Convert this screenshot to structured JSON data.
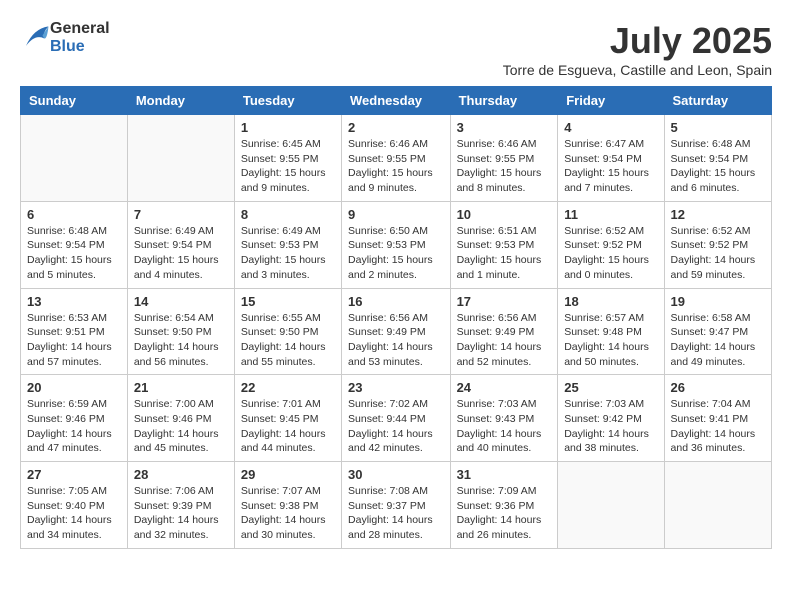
{
  "header": {
    "logo_general": "General",
    "logo_blue": "Blue",
    "month_title": "July 2025",
    "location": "Torre de Esgueva, Castille and Leon, Spain"
  },
  "calendar": {
    "days_of_week": [
      "Sunday",
      "Monday",
      "Tuesday",
      "Wednesday",
      "Thursday",
      "Friday",
      "Saturday"
    ],
    "weeks": [
      [
        {
          "day": "",
          "sunrise": "",
          "sunset": "",
          "daylight": "",
          "empty": true
        },
        {
          "day": "",
          "sunrise": "",
          "sunset": "",
          "daylight": "",
          "empty": true
        },
        {
          "day": "1",
          "sunrise": "Sunrise: 6:45 AM",
          "sunset": "Sunset: 9:55 PM",
          "daylight": "Daylight: 15 hours and 9 minutes."
        },
        {
          "day": "2",
          "sunrise": "Sunrise: 6:46 AM",
          "sunset": "Sunset: 9:55 PM",
          "daylight": "Daylight: 15 hours and 9 minutes."
        },
        {
          "day": "3",
          "sunrise": "Sunrise: 6:46 AM",
          "sunset": "Sunset: 9:55 PM",
          "daylight": "Daylight: 15 hours and 8 minutes."
        },
        {
          "day": "4",
          "sunrise": "Sunrise: 6:47 AM",
          "sunset": "Sunset: 9:54 PM",
          "daylight": "Daylight: 15 hours and 7 minutes."
        },
        {
          "day": "5",
          "sunrise": "Sunrise: 6:48 AM",
          "sunset": "Sunset: 9:54 PM",
          "daylight": "Daylight: 15 hours and 6 minutes."
        }
      ],
      [
        {
          "day": "6",
          "sunrise": "Sunrise: 6:48 AM",
          "sunset": "Sunset: 9:54 PM",
          "daylight": "Daylight: 15 hours and 5 minutes."
        },
        {
          "day": "7",
          "sunrise": "Sunrise: 6:49 AM",
          "sunset": "Sunset: 9:54 PM",
          "daylight": "Daylight: 15 hours and 4 minutes."
        },
        {
          "day": "8",
          "sunrise": "Sunrise: 6:49 AM",
          "sunset": "Sunset: 9:53 PM",
          "daylight": "Daylight: 15 hours and 3 minutes."
        },
        {
          "day": "9",
          "sunrise": "Sunrise: 6:50 AM",
          "sunset": "Sunset: 9:53 PM",
          "daylight": "Daylight: 15 hours and 2 minutes."
        },
        {
          "day": "10",
          "sunrise": "Sunrise: 6:51 AM",
          "sunset": "Sunset: 9:53 PM",
          "daylight": "Daylight: 15 hours and 1 minute."
        },
        {
          "day": "11",
          "sunrise": "Sunrise: 6:52 AM",
          "sunset": "Sunset: 9:52 PM",
          "daylight": "Daylight: 15 hours and 0 minutes."
        },
        {
          "day": "12",
          "sunrise": "Sunrise: 6:52 AM",
          "sunset": "Sunset: 9:52 PM",
          "daylight": "Daylight: 14 hours and 59 minutes."
        }
      ],
      [
        {
          "day": "13",
          "sunrise": "Sunrise: 6:53 AM",
          "sunset": "Sunset: 9:51 PM",
          "daylight": "Daylight: 14 hours and 57 minutes."
        },
        {
          "day": "14",
          "sunrise": "Sunrise: 6:54 AM",
          "sunset": "Sunset: 9:50 PM",
          "daylight": "Daylight: 14 hours and 56 minutes."
        },
        {
          "day": "15",
          "sunrise": "Sunrise: 6:55 AM",
          "sunset": "Sunset: 9:50 PM",
          "daylight": "Daylight: 14 hours and 55 minutes."
        },
        {
          "day": "16",
          "sunrise": "Sunrise: 6:56 AM",
          "sunset": "Sunset: 9:49 PM",
          "daylight": "Daylight: 14 hours and 53 minutes."
        },
        {
          "day": "17",
          "sunrise": "Sunrise: 6:56 AM",
          "sunset": "Sunset: 9:49 PM",
          "daylight": "Daylight: 14 hours and 52 minutes."
        },
        {
          "day": "18",
          "sunrise": "Sunrise: 6:57 AM",
          "sunset": "Sunset: 9:48 PM",
          "daylight": "Daylight: 14 hours and 50 minutes."
        },
        {
          "day": "19",
          "sunrise": "Sunrise: 6:58 AM",
          "sunset": "Sunset: 9:47 PM",
          "daylight": "Daylight: 14 hours and 49 minutes."
        }
      ],
      [
        {
          "day": "20",
          "sunrise": "Sunrise: 6:59 AM",
          "sunset": "Sunset: 9:46 PM",
          "daylight": "Daylight: 14 hours and 47 minutes."
        },
        {
          "day": "21",
          "sunrise": "Sunrise: 7:00 AM",
          "sunset": "Sunset: 9:46 PM",
          "daylight": "Daylight: 14 hours and 45 minutes."
        },
        {
          "day": "22",
          "sunrise": "Sunrise: 7:01 AM",
          "sunset": "Sunset: 9:45 PM",
          "daylight": "Daylight: 14 hours and 44 minutes."
        },
        {
          "day": "23",
          "sunrise": "Sunrise: 7:02 AM",
          "sunset": "Sunset: 9:44 PM",
          "daylight": "Daylight: 14 hours and 42 minutes."
        },
        {
          "day": "24",
          "sunrise": "Sunrise: 7:03 AM",
          "sunset": "Sunset: 9:43 PM",
          "daylight": "Daylight: 14 hours and 40 minutes."
        },
        {
          "day": "25",
          "sunrise": "Sunrise: 7:03 AM",
          "sunset": "Sunset: 9:42 PM",
          "daylight": "Daylight: 14 hours and 38 minutes."
        },
        {
          "day": "26",
          "sunrise": "Sunrise: 7:04 AM",
          "sunset": "Sunset: 9:41 PM",
          "daylight": "Daylight: 14 hours and 36 minutes."
        }
      ],
      [
        {
          "day": "27",
          "sunrise": "Sunrise: 7:05 AM",
          "sunset": "Sunset: 9:40 PM",
          "daylight": "Daylight: 14 hours and 34 minutes."
        },
        {
          "day": "28",
          "sunrise": "Sunrise: 7:06 AM",
          "sunset": "Sunset: 9:39 PM",
          "daylight": "Daylight: 14 hours and 32 minutes."
        },
        {
          "day": "29",
          "sunrise": "Sunrise: 7:07 AM",
          "sunset": "Sunset: 9:38 PM",
          "daylight": "Daylight: 14 hours and 30 minutes."
        },
        {
          "day": "30",
          "sunrise": "Sunrise: 7:08 AM",
          "sunset": "Sunset: 9:37 PM",
          "daylight": "Daylight: 14 hours and 28 minutes."
        },
        {
          "day": "31",
          "sunrise": "Sunrise: 7:09 AM",
          "sunset": "Sunset: 9:36 PM",
          "daylight": "Daylight: 14 hours and 26 minutes."
        },
        {
          "day": "",
          "sunrise": "",
          "sunset": "",
          "daylight": "",
          "empty": true
        },
        {
          "day": "",
          "sunrise": "",
          "sunset": "",
          "daylight": "",
          "empty": true
        }
      ]
    ]
  }
}
